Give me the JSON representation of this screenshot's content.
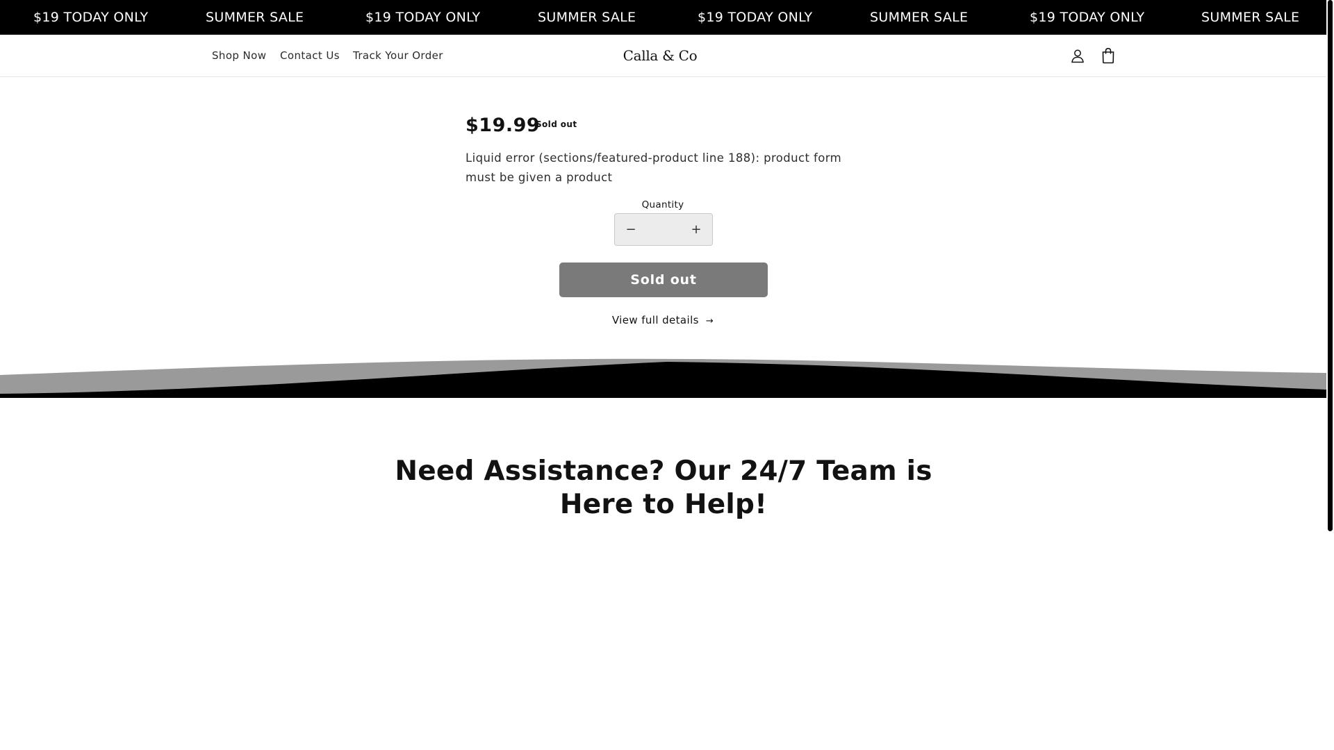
{
  "announcement": {
    "items": [
      "$19 TODAY ONLY",
      "SUMMER SALE",
      "$19 TODAY ONLY",
      "SUMMER SALE",
      "$19 TODAY ONLY",
      "SUMMER SALE",
      "$19 TODAY ONLY",
      "SUMMER SALE"
    ]
  },
  "header": {
    "nav": [
      "Shop Now",
      "Contact Us",
      "Track Your Order"
    ],
    "logo": "Calla & Co",
    "account_icon": "account-icon",
    "cart_icon": "cart-bag-icon"
  },
  "product": {
    "price": "$19.99",
    "badge": "Sold out",
    "error": "Liquid error (sections/featured-product line 188): product form must be given a product",
    "quantity_label": "Quantity",
    "quantity_value": "",
    "decrease_symbol": "−",
    "increase_symbol": "+",
    "sold_out_button": "Sold out",
    "view_details": "View full details",
    "view_details_arrow": "→"
  },
  "help": {
    "heading": "Need Assistance? Our 24/7 Team is Here to Help!"
  },
  "colors": {
    "announcement_bg": "#000000",
    "sold_out_button_bg": "#7a7a7a",
    "wave_dark": "#000000",
    "wave_light": "#9a9a9a"
  }
}
